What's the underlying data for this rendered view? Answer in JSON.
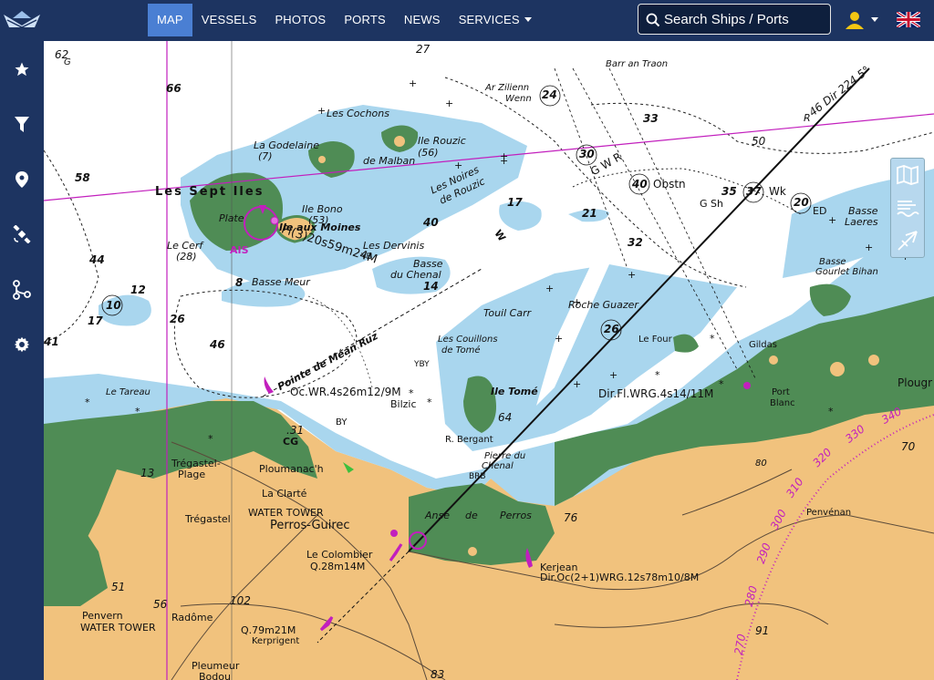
{
  "nav": {
    "items": [
      {
        "label": "MAP",
        "active": true
      },
      {
        "label": "VESSELS"
      },
      {
        "label": "PHOTOS"
      },
      {
        "label": "PORTS"
      },
      {
        "label": "NEWS"
      },
      {
        "label": "SERVICES",
        "dropdown": true
      }
    ]
  },
  "search": {
    "placeholder": "Search Ships / Ports"
  },
  "sidebar": {
    "icons": [
      "star-icon",
      "filter-icon",
      "map-pin-icon",
      "satellite-icon",
      "route-icon",
      "gear-icon"
    ]
  },
  "colors": {
    "header": "#1d3461",
    "active": "#4a7fd3",
    "sea_shallow": "#a9d6ee",
    "land": "#f1c27d",
    "foreshore": "#4f8c55",
    "magenta": "#c21fbd"
  },
  "map": {
    "labels": {
      "sept_iles": "Les Sept Iles",
      "cochons": "Les Cochons",
      "godelaine": "La Godelaine",
      "godelaine_n": "(7)",
      "rouzic": "Ile Rouzic",
      "rouzic_n": "(56)",
      "malban": "de Malban",
      "noires": "Les Noires",
      "noires2": "de Rouzic",
      "plate": "Plate",
      "bono": "Ile Bono",
      "bono_n": "(53)",
      "moines": "Ile aux Moines",
      "ais": "AIS",
      "light1": "Fl(3)20s59m24M",
      "dervinis": "Les Dervinis",
      "yb": "YB",
      "cerf": "Le Cerf",
      "cerf_n": "(28)",
      "basse_meur": "Basse Meur",
      "basse_chenal": "Basse",
      "basse_chenal2": "du Chenal",
      "mean_ruz": "Pointe de Méan Ruz",
      "oc_wr": "Oc.WR.4s26m12/9M",
      "tareau": "Le Tareau",
      "touil": "Touil Carr",
      "couillons": "Les Couillons",
      "couillons2": "de Tomé",
      "ybyl": "YBY",
      "roche_guaze": "Roche Guazer",
      "le_four": "Le Four",
      "ile_tome": "Ile Tomé",
      "dir_fl": "Dir.Fl.WRG.4s14/11M",
      "bilzic": "Bilzic",
      "by": "BY",
      "bergant": "R. Bergant",
      "pierre": "Pierre du",
      "pierre2": "Chenal",
      "brb": "BRB",
      "zilienn": "Ar Zilienn",
      "wenn": "Wenn",
      "barr": "Barr an Traon",
      "obstn": "Obstn",
      "gsh": "G Sh",
      "wk": "Wk",
      "ed": "ED",
      "basse_laeres": "Basse",
      "basse_laeres2": "Laeres",
      "gourlet": "Basse",
      "gourlet2": "Gourlet Bihan",
      "gildas": "Gildas",
      "port_blanc": "Port",
      "port_blanc2": "Blanc",
      "plougr": "Plougr",
      "tregastel_plage": "Trégastel-",
      "tregastel_plage2": "Plage",
      "ploumanach": "Ploumanac'h",
      "cg": "CG",
      "clarte": "La Clarté",
      "tregastel": "Trégastel",
      "water_tower1": "WATER TOWER",
      "perros": "Perros-Guirec",
      "anse": "Anse",
      "anse_de": "de",
      "anse_perros": "Perros",
      "colombier": "Le Colombier",
      "colombier_l": "Q.28m14M",
      "kerjean": "Kerjean",
      "kerjean_l": "Dir.Oc(2+1)WRG.12s78m10/8M",
      "penvenan": "Penvénan",
      "penvern": "Penvern",
      "water_tower2": "WATER TOWER",
      "radome": "Radôme",
      "q79": "Q.79m21M",
      "kerprigent": "Kerprigent",
      "pleumeur": "Pleumeur",
      "bodou": "Bodou",
      "dir224": "46 Dir 224.5°",
      "w": "W",
      "gwr": "G W R",
      "r": "R"
    },
    "depths": [
      "62",
      "G",
      "27",
      "66",
      "58",
      "44",
      "12",
      "10",
      "17",
      "26",
      "41",
      "46",
      "40",
      "24",
      "33",
      "30",
      "40",
      "17",
      "21",
      "35",
      "37",
      "20",
      "32",
      "50",
      "26",
      ".31",
      "13",
      "51",
      "56",
      "102",
      "76",
      "91",
      "70",
      "80",
      "83",
      "8",
      "14",
      "64"
    ],
    "compass": [
      "270",
      "280",
      "290",
      "300",
      "310",
      "320",
      "330",
      "340"
    ]
  }
}
